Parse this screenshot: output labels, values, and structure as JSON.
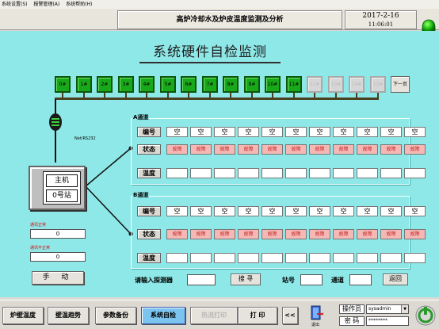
{
  "menu": [
    "系统设置(S)",
    "报警管理(A)",
    "系统帮助(H)"
  ],
  "header": {
    "title": "高炉冷却水及炉皮温度监测及分析",
    "date": "2017-2-16",
    "time": "11:06:01"
  },
  "main_title": "系统硬件自检监测",
  "devices": [
    {
      "label": "0#",
      "active": true
    },
    {
      "label": "1#",
      "active": true
    },
    {
      "label": "2#",
      "active": true
    },
    {
      "label": "3#",
      "active": true
    },
    {
      "label": "4#",
      "active": true
    },
    {
      "label": "5#",
      "active": true
    },
    {
      "label": "6#",
      "active": true
    },
    {
      "label": "7#",
      "active": true
    },
    {
      "label": "8#",
      "active": true
    },
    {
      "label": "9#",
      "active": true
    },
    {
      "label": "10#",
      "active": true
    },
    {
      "label": "11#",
      "active": true
    },
    {
      "label": "12#",
      "active": false
    },
    {
      "label": "13#",
      "active": false
    },
    {
      "label": "14#",
      "active": false
    },
    {
      "label": "15#",
      "active": false
    }
  ],
  "next_page": "下一页",
  "net_label": "Net/RS232",
  "host": {
    "line1": "主机",
    "line2": "0号站"
  },
  "status_boxes": [
    {
      "label": "通讯正常",
      "value": "0"
    },
    {
      "label": "通讯不正常",
      "value": "0"
    }
  ],
  "manual_button": "手 动",
  "channel_a": {
    "title": "A通道",
    "row_labels": [
      "编号",
      "状态",
      "温度"
    ],
    "ids": [
      "空",
      "空",
      "空",
      "空",
      "空",
      "空",
      "空",
      "空",
      "空",
      "空",
      "空"
    ],
    "status": [
      "故障",
      "故障",
      "故障",
      "故障",
      "故障",
      "故障",
      "故障",
      "故障",
      "故障",
      "故障",
      "故障"
    ]
  },
  "channel_b": {
    "title": "B通道",
    "row_labels": [
      "编号",
      "状态",
      "温度"
    ],
    "ids": [
      "空",
      "空",
      "空",
      "空",
      "空",
      "空",
      "空",
      "空",
      "空",
      "空",
      "空"
    ],
    "status": [
      "故障",
      "故障",
      "故障",
      "故障",
      "故障",
      "故障",
      "故障",
      "故障",
      "故障",
      "故障",
      "故障"
    ]
  },
  "search": {
    "probe_label": "请输入探测器",
    "search_button": "搜 寻",
    "station_label": "站号",
    "channel_label": "通道",
    "back_button": "返回"
  },
  "bottom": {
    "tabs": [
      "炉壁温度",
      "壁温趋势",
      "参数备份",
      "系统自检",
      "热流打印",
      "打 印",
      "<<"
    ],
    "exit_label": "退出",
    "operator_label": "操作员",
    "operator_value": "sysadmin",
    "password_label": "密 码",
    "password_value": "********"
  },
  "colors": {
    "background": "#8fe8e8",
    "device_on": "#19a819",
    "fault": "#f5b8b5",
    "active_tab": "#7cc4f0"
  }
}
